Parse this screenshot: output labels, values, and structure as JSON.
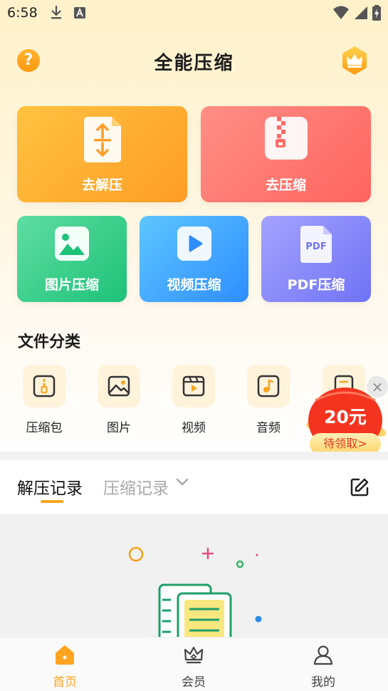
{
  "status_bar": {
    "time": "6:58"
  },
  "header": {
    "title": "全能压缩",
    "help_icon_text": "?"
  },
  "feature_cards": {
    "decompress": {
      "label": "去解压"
    },
    "compress": {
      "label": "去压缩"
    },
    "image": {
      "label": "图片压缩"
    },
    "video": {
      "label": "视频压缩"
    },
    "pdf": {
      "label": "PDF压缩",
      "icon_text": "PDF"
    }
  },
  "categories": {
    "title": "文件分类",
    "items": [
      {
        "label": "压缩包",
        "icon": "archive-icon"
      },
      {
        "label": "图片",
        "icon": "image-icon"
      },
      {
        "label": "视频",
        "icon": "video-icon"
      },
      {
        "label": "音频",
        "icon": "music-icon"
      },
      {
        "label": "",
        "icon": "document-icon"
      }
    ]
  },
  "promo": {
    "amount": "20元",
    "claim": "待领取>"
  },
  "records_tabs": {
    "active": "解压记录",
    "inactive": "压缩记录"
  },
  "bottom_nav": {
    "home": "首页",
    "member": "会员",
    "mine": "我的"
  },
  "colors": {
    "accent": "#ffa41f",
    "decompress_card": "#ff9d26",
    "compress_card": "#ff6460",
    "image_card": "#1dc278",
    "video_card": "#2e8dff",
    "pdf_card": "#6f72f5"
  }
}
